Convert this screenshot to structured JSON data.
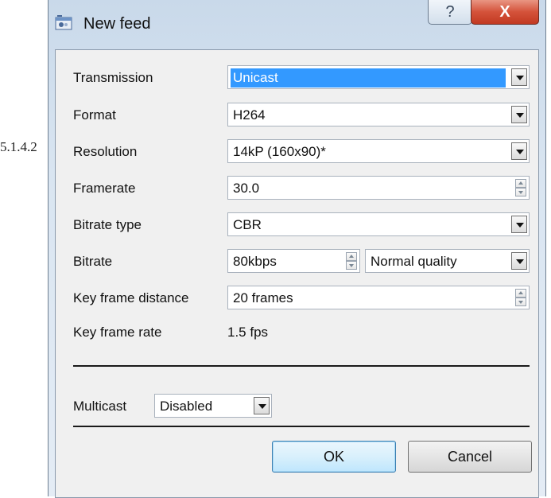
{
  "side_text": "5.1.4.2",
  "window": {
    "title": "New feed",
    "help_glyph": "?",
    "close_glyph": "X"
  },
  "form": {
    "transmission": {
      "label": "Transmission",
      "value": "Unicast"
    },
    "format": {
      "label": "Format",
      "value": "H264"
    },
    "resolution": {
      "label": "Resolution",
      "value": "14kP (160x90)*"
    },
    "framerate": {
      "label": "Framerate",
      "value": "30.0"
    },
    "bitrate_type": {
      "label": "Bitrate type",
      "value": "CBR"
    },
    "bitrate": {
      "label": "Bitrate",
      "value": "80kbps",
      "quality": "Normal quality"
    },
    "key_frame_distance": {
      "label": "Key frame distance",
      "value": "20 frames"
    },
    "key_frame_rate": {
      "label": "Key frame rate",
      "value": "1.5 fps"
    },
    "multicast": {
      "label": "Multicast",
      "value": "Disabled"
    }
  },
  "buttons": {
    "ok": "OK",
    "cancel": "Cancel"
  },
  "colors": {
    "selection": "#3399ff",
    "close_button": "#c23a22"
  },
  "icons": {
    "title": "feed-icon",
    "dropdown": "chevron-down-icon",
    "spinner": "spinner-arrows-icon"
  }
}
